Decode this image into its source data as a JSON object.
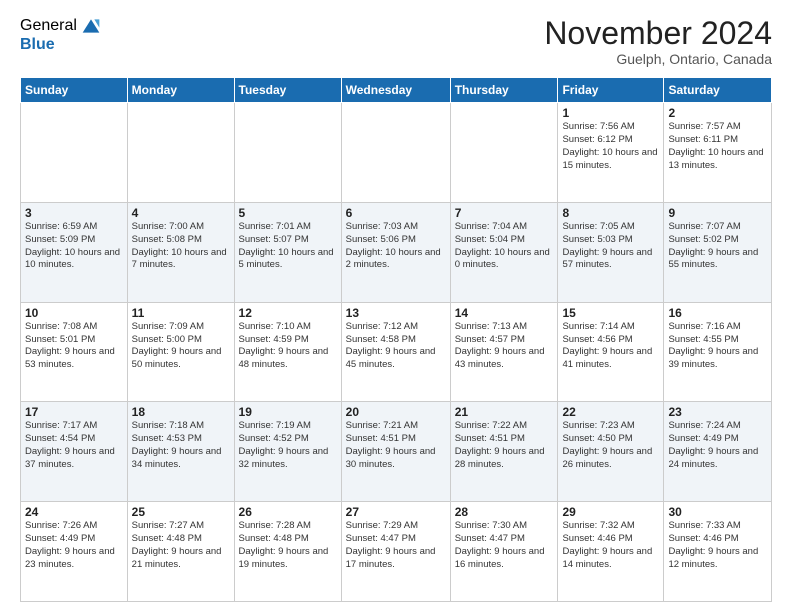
{
  "header": {
    "logo_general": "General",
    "logo_blue": "Blue",
    "title": "November 2024",
    "location": "Guelph, Ontario, Canada"
  },
  "weekdays": [
    "Sunday",
    "Monday",
    "Tuesday",
    "Wednesday",
    "Thursday",
    "Friday",
    "Saturday"
  ],
  "weeks": [
    [
      {
        "day": "",
        "info": ""
      },
      {
        "day": "",
        "info": ""
      },
      {
        "day": "",
        "info": ""
      },
      {
        "day": "",
        "info": ""
      },
      {
        "day": "",
        "info": ""
      },
      {
        "day": "1",
        "info": "Sunrise: 7:56 AM\nSunset: 6:12 PM\nDaylight: 10 hours and 15 minutes."
      },
      {
        "day": "2",
        "info": "Sunrise: 7:57 AM\nSunset: 6:11 PM\nDaylight: 10 hours and 13 minutes."
      }
    ],
    [
      {
        "day": "3",
        "info": "Sunrise: 6:59 AM\nSunset: 5:09 PM\nDaylight: 10 hours and 10 minutes."
      },
      {
        "day": "4",
        "info": "Sunrise: 7:00 AM\nSunset: 5:08 PM\nDaylight: 10 hours and 7 minutes."
      },
      {
        "day": "5",
        "info": "Sunrise: 7:01 AM\nSunset: 5:07 PM\nDaylight: 10 hours and 5 minutes."
      },
      {
        "day": "6",
        "info": "Sunrise: 7:03 AM\nSunset: 5:06 PM\nDaylight: 10 hours and 2 minutes."
      },
      {
        "day": "7",
        "info": "Sunrise: 7:04 AM\nSunset: 5:04 PM\nDaylight: 10 hours and 0 minutes."
      },
      {
        "day": "8",
        "info": "Sunrise: 7:05 AM\nSunset: 5:03 PM\nDaylight: 9 hours and 57 minutes."
      },
      {
        "day": "9",
        "info": "Sunrise: 7:07 AM\nSunset: 5:02 PM\nDaylight: 9 hours and 55 minutes."
      }
    ],
    [
      {
        "day": "10",
        "info": "Sunrise: 7:08 AM\nSunset: 5:01 PM\nDaylight: 9 hours and 53 minutes."
      },
      {
        "day": "11",
        "info": "Sunrise: 7:09 AM\nSunset: 5:00 PM\nDaylight: 9 hours and 50 minutes."
      },
      {
        "day": "12",
        "info": "Sunrise: 7:10 AM\nSunset: 4:59 PM\nDaylight: 9 hours and 48 minutes."
      },
      {
        "day": "13",
        "info": "Sunrise: 7:12 AM\nSunset: 4:58 PM\nDaylight: 9 hours and 45 minutes."
      },
      {
        "day": "14",
        "info": "Sunrise: 7:13 AM\nSunset: 4:57 PM\nDaylight: 9 hours and 43 minutes."
      },
      {
        "day": "15",
        "info": "Sunrise: 7:14 AM\nSunset: 4:56 PM\nDaylight: 9 hours and 41 minutes."
      },
      {
        "day": "16",
        "info": "Sunrise: 7:16 AM\nSunset: 4:55 PM\nDaylight: 9 hours and 39 minutes."
      }
    ],
    [
      {
        "day": "17",
        "info": "Sunrise: 7:17 AM\nSunset: 4:54 PM\nDaylight: 9 hours and 37 minutes."
      },
      {
        "day": "18",
        "info": "Sunrise: 7:18 AM\nSunset: 4:53 PM\nDaylight: 9 hours and 34 minutes."
      },
      {
        "day": "19",
        "info": "Sunrise: 7:19 AM\nSunset: 4:52 PM\nDaylight: 9 hours and 32 minutes."
      },
      {
        "day": "20",
        "info": "Sunrise: 7:21 AM\nSunset: 4:51 PM\nDaylight: 9 hours and 30 minutes."
      },
      {
        "day": "21",
        "info": "Sunrise: 7:22 AM\nSunset: 4:51 PM\nDaylight: 9 hours and 28 minutes."
      },
      {
        "day": "22",
        "info": "Sunrise: 7:23 AM\nSunset: 4:50 PM\nDaylight: 9 hours and 26 minutes."
      },
      {
        "day": "23",
        "info": "Sunrise: 7:24 AM\nSunset: 4:49 PM\nDaylight: 9 hours and 24 minutes."
      }
    ],
    [
      {
        "day": "24",
        "info": "Sunrise: 7:26 AM\nSunset: 4:49 PM\nDaylight: 9 hours and 23 minutes."
      },
      {
        "day": "25",
        "info": "Sunrise: 7:27 AM\nSunset: 4:48 PM\nDaylight: 9 hours and 21 minutes."
      },
      {
        "day": "26",
        "info": "Sunrise: 7:28 AM\nSunset: 4:48 PM\nDaylight: 9 hours and 19 minutes."
      },
      {
        "day": "27",
        "info": "Sunrise: 7:29 AM\nSunset: 4:47 PM\nDaylight: 9 hours and 17 minutes."
      },
      {
        "day": "28",
        "info": "Sunrise: 7:30 AM\nSunset: 4:47 PM\nDaylight: 9 hours and 16 minutes."
      },
      {
        "day": "29",
        "info": "Sunrise: 7:32 AM\nSunset: 4:46 PM\nDaylight: 9 hours and 14 minutes."
      },
      {
        "day": "30",
        "info": "Sunrise: 7:33 AM\nSunset: 4:46 PM\nDaylight: 9 hours and 12 minutes."
      }
    ]
  ]
}
